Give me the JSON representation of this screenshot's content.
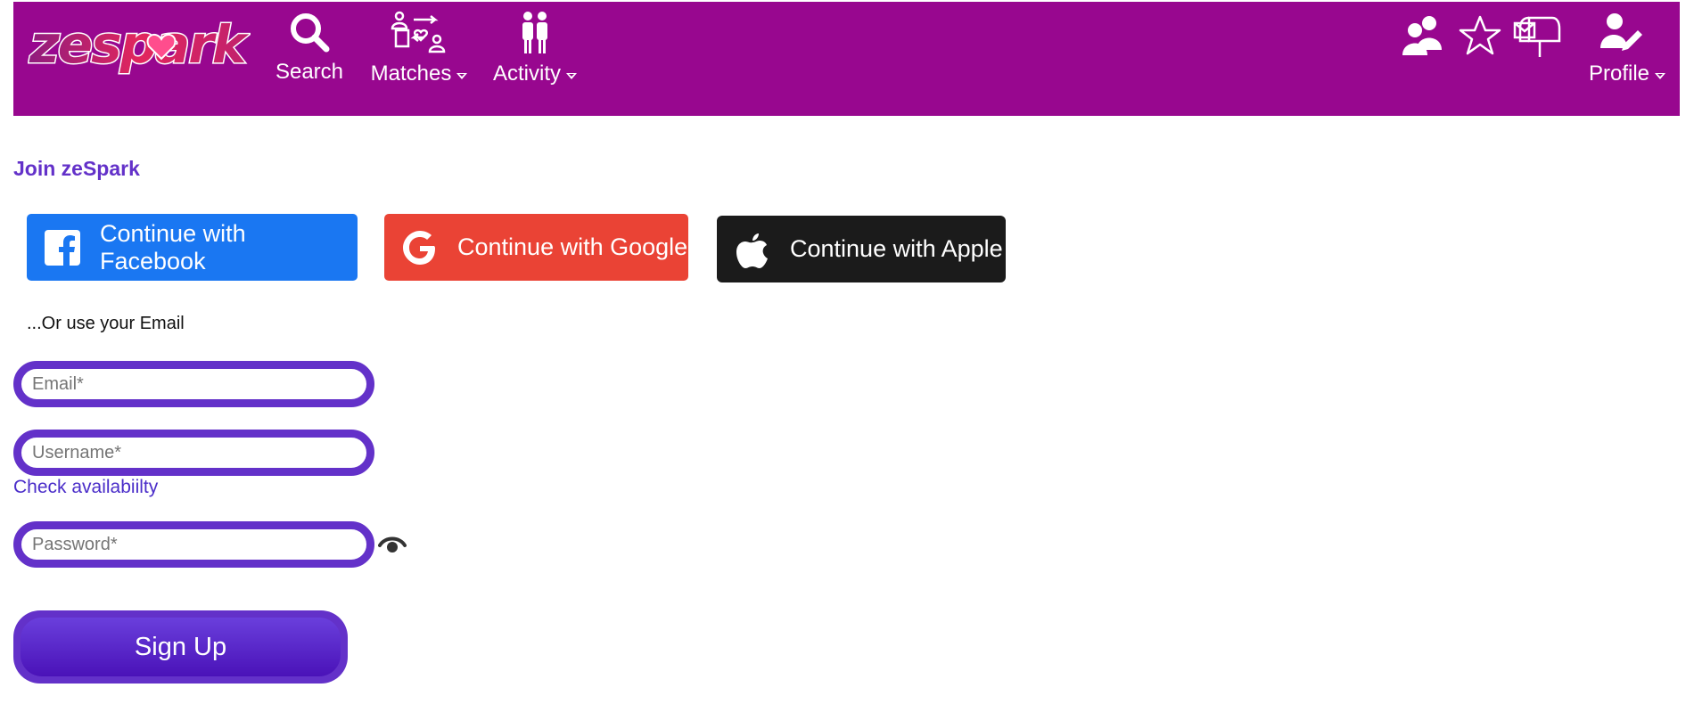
{
  "brand": {
    "logo_text": "zeSpark"
  },
  "nav": {
    "search": "Search",
    "matches": "Matches",
    "activity": "Activity",
    "profile": "Profile"
  },
  "page": {
    "title": "Join zeSpark",
    "or_text": "...Or use your Email",
    "check_availability": "Check availabiilty",
    "signup_label": "Sign Up"
  },
  "social": {
    "facebook": "Continue with Facebook",
    "google": "Continue with Google",
    "apple": "Continue with Apple"
  },
  "form": {
    "email_placeholder": "Email*",
    "username_placeholder": "Username*",
    "password_placeholder": "Password*"
  },
  "colors": {
    "header_bg": "#98078f",
    "accent": "#6331c9",
    "facebook": "#1a77f2",
    "google": "#ea4335",
    "apple": "#1b1b1b"
  },
  "icons": {
    "search": "search-icon",
    "matches": "matches-icon",
    "activity": "activity-icon",
    "friends": "friends-icon",
    "favorites": "star-icon",
    "mail": "mailbox-icon",
    "profile": "profile-edit-icon",
    "password_toggle": "eye-icon"
  }
}
